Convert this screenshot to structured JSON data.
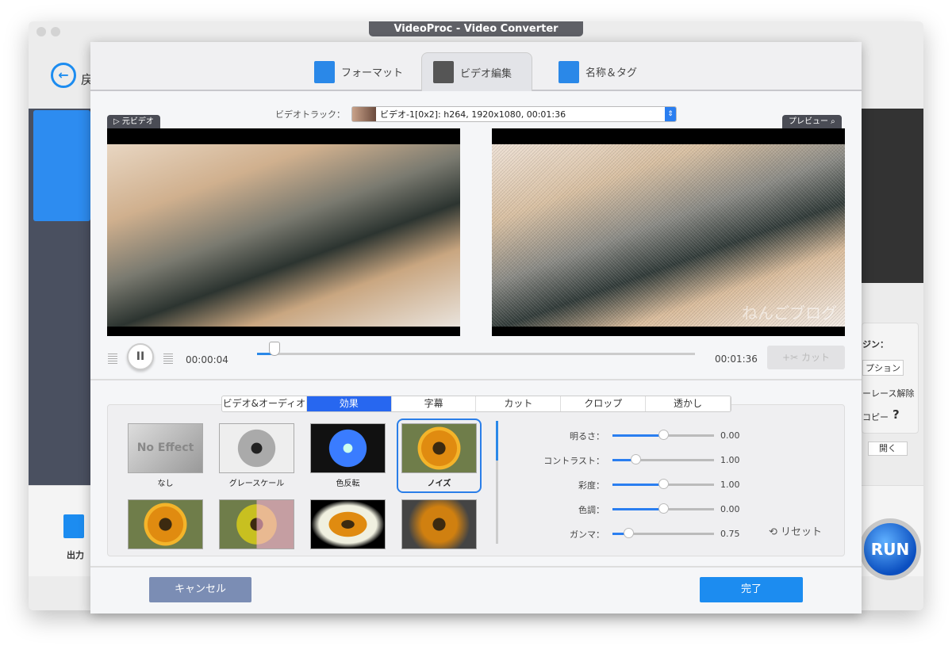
{
  "window": {
    "title": "VideoProc - Video Converter"
  },
  "background": {
    "back_label": "戻",
    "output_label": "出力",
    "right_labels": [
      "ジン：",
      "プション",
      "ーレース解除",
      "コピー",
      "?",
      "開く"
    ],
    "run_label": "RUN"
  },
  "dialog": {
    "tabs": [
      {
        "label": "フォーマット",
        "icon": "format-settings-icon"
      },
      {
        "label": "ビデオ編集",
        "icon": "video-edit-scissors-icon",
        "active": true
      },
      {
        "label": "名称＆タグ",
        "icon": "name-tag-edit-icon"
      }
    ],
    "video_track": {
      "label": "ビデオトラック：",
      "value": "ビデオ-1[0x2]: h264, 1920x1080, 00:01:36"
    },
    "original_label": "元ビデオ",
    "preview_label": "プレビュー",
    "watermark_text": "ねんごブログ",
    "player": {
      "current_time": "00:00:04",
      "duration": "00:01:36",
      "progress_percent": 4,
      "cut_label": "カット"
    },
    "subtabs": [
      {
        "label": "ビデオ&オーディオ"
      },
      {
        "label": "効果",
        "active": true
      },
      {
        "label": "字幕"
      },
      {
        "label": "カット"
      },
      {
        "label": "クロップ"
      },
      {
        "label": "透かし"
      }
    ],
    "effects": [
      {
        "label": "なし",
        "thumb_text": "No Effect"
      },
      {
        "label": "グレースケール"
      },
      {
        "label": "色反転"
      },
      {
        "label": "ノイズ",
        "selected": true
      },
      {
        "label": ""
      },
      {
        "label": ""
      },
      {
        "label": ""
      },
      {
        "label": ""
      }
    ],
    "adjustments": [
      {
        "label": "明るさ：",
        "value": "0.00",
        "position_percent": 50
      },
      {
        "label": "コントラスト：",
        "value": "1.00",
        "position_percent": 23
      },
      {
        "label": "彩度：",
        "value": "1.00",
        "position_percent": 50
      },
      {
        "label": "色調：",
        "value": "0.00",
        "position_percent": 50
      },
      {
        "label": "ガンマ：",
        "value": "0.75",
        "position_percent": 16
      }
    ],
    "reset_label": "リセット",
    "cancel_label": "キャンセル",
    "done_label": "完了"
  },
  "colors": {
    "accent": "#1c8cf0",
    "tab_active": "#2767f0",
    "cancel": "#7b8db4"
  }
}
